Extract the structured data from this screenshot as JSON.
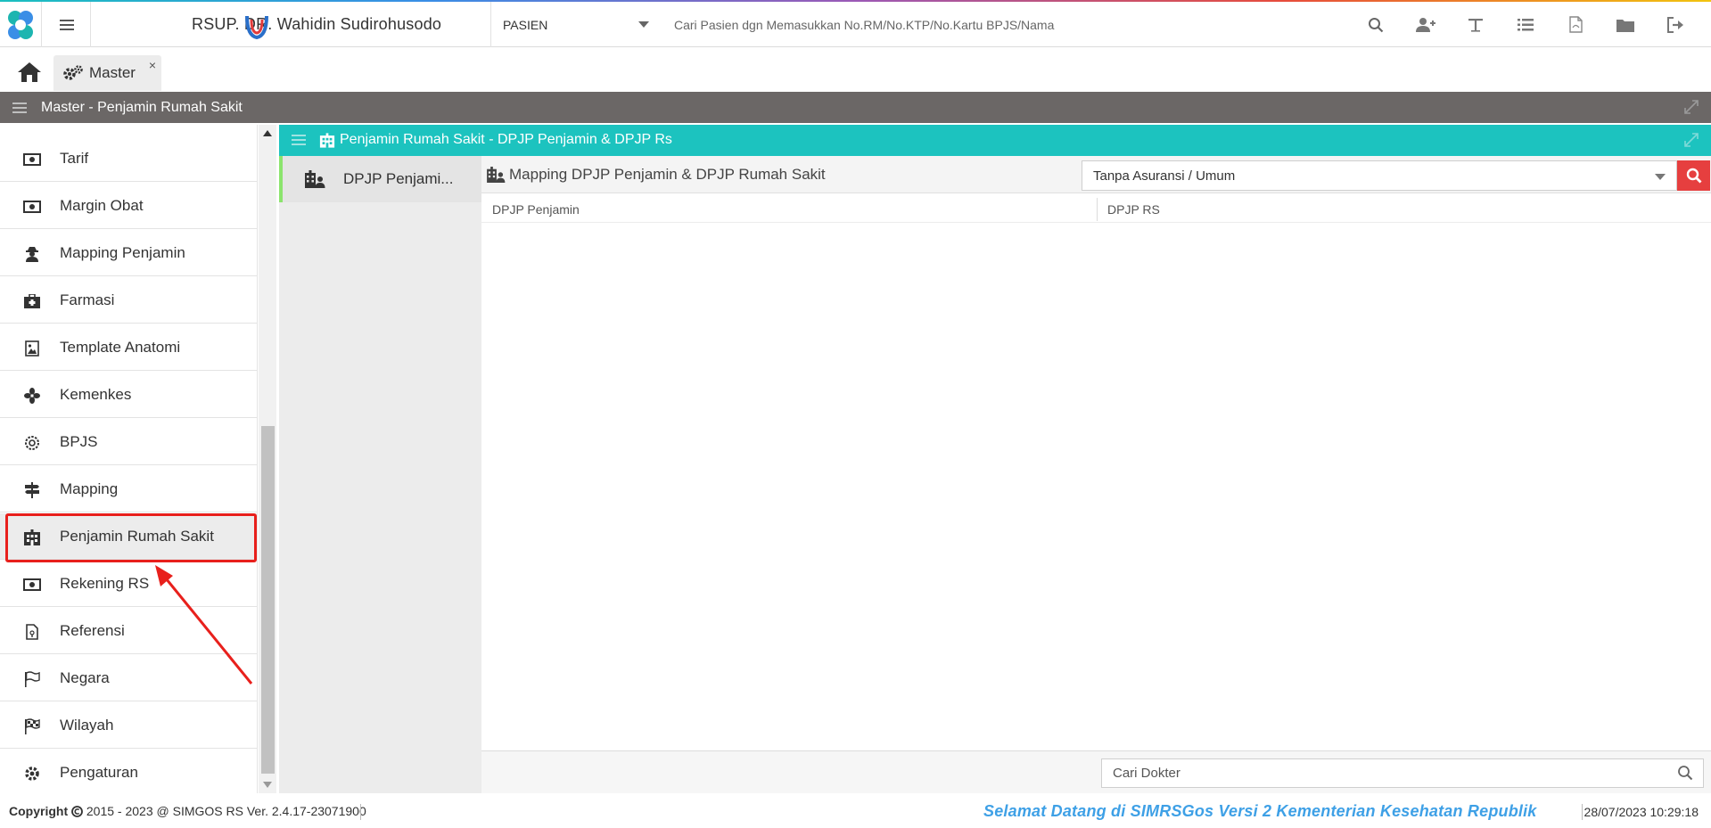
{
  "header": {
    "hospital_name": "RSUP. DR. Wahidin Sudirohusodo",
    "search_type": "PASIEN",
    "search_placeholder": "Cari Pasien dgn Memasukkan No.RM/No.KTP/No.Kartu BPJS/Nama",
    "icons": [
      "search-icon",
      "add-user-icon",
      "text-icon",
      "list-icon",
      "pdf-icon",
      "folder-icon",
      "logout-icon"
    ]
  },
  "tabs": {
    "master_label": "Master",
    "close_label": "×"
  },
  "panel": {
    "title": "Master - Penjamin Rumah Sakit"
  },
  "sidebar": {
    "items": [
      {
        "label": "Tarif",
        "icon": "money-icon"
      },
      {
        "label": "Margin Obat",
        "icon": "money-icon"
      },
      {
        "label": "Mapping Penjamin",
        "icon": "user-secret-icon"
      },
      {
        "label": "Farmasi",
        "icon": "medkit-icon"
      },
      {
        "label": "Template Anatomi",
        "icon": "image-icon"
      },
      {
        "label": "Kemenkes",
        "icon": "fan-icon"
      },
      {
        "label": "BPJS",
        "icon": "cog-icon"
      },
      {
        "label": "Mapping",
        "icon": "signs-icon"
      },
      {
        "label": "Penjamin Rumah Sakit",
        "icon": "building-icon"
      },
      {
        "label": "Rekening RS",
        "icon": "money-icon"
      },
      {
        "label": "Referensi",
        "icon": "file-icon"
      },
      {
        "label": "Negara",
        "icon": "flag-icon"
      },
      {
        "label": "Wilayah",
        "icon": "checkered-flag-icon"
      },
      {
        "label": "Pengaturan",
        "icon": "gear-icon"
      }
    ],
    "active_index": 8
  },
  "content": {
    "title": "Penjamin Rumah Sakit - DPJP Penjamin & DPJP Rs",
    "subnav_label": "DPJP Penjami...",
    "toolbar_title": "Mapping DPJP Penjamin & DPJP Rumah Sakit",
    "penjamin_value": "Tanpa Asuransi / Umum",
    "columns": [
      "DPJP Penjamin",
      "DPJP RS"
    ],
    "doctor_search_placeholder": "Cari Dokter"
  },
  "status": {
    "copyright_bold": "Copyright",
    "copyright_rest": "2015 - 2023 @ SIMGOS RS Ver. 2.4.17-23071900",
    "marquee": "Selamat Datang di SIMRSGos Versi 2 Kementerian Kesehatan Republik",
    "datetime": "28/07/2023 10:29:18"
  },
  "colors": {
    "teal": "#1cc3bf",
    "panel_gray": "#6b6766",
    "danger_red": "#e63f3f",
    "highlight_red": "#e8201c",
    "active_green": "#8be46d",
    "marquee_blue": "#3ea0e6"
  }
}
